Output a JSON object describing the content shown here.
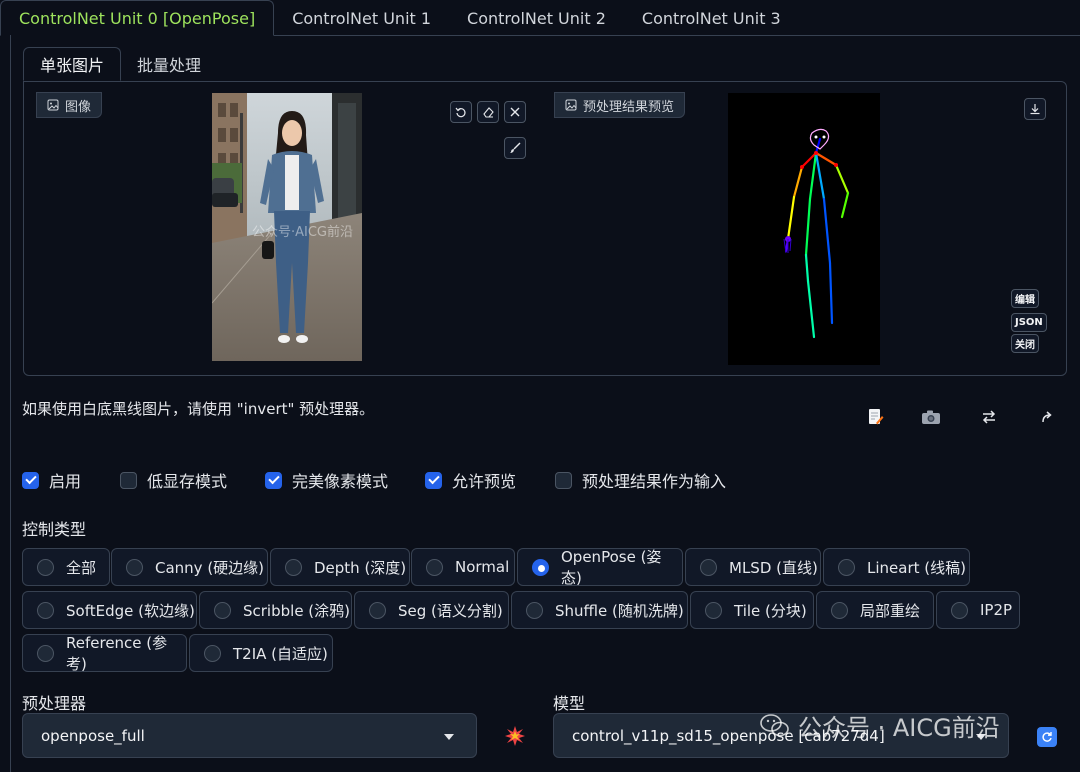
{
  "unit_tabs": [
    "ControlNet Unit 0 [OpenPose]",
    "ControlNet Unit 1",
    "ControlNet Unit 2",
    "ControlNet Unit 3"
  ],
  "sub_tabs": [
    "单张图片",
    "批量处理"
  ],
  "image_label": "图像",
  "preview_label": "预处理结果预览",
  "pose_buttons": {
    "edit": "编辑",
    "json": "JSON",
    "close": "关闭"
  },
  "photo_watermark": "公众号·AICG前沿",
  "hint": "如果使用白底黑线图片，请使用 \"invert\" 预处理器。",
  "checkboxes": [
    {
      "label": "启用",
      "checked": true
    },
    {
      "label": "低显存模式",
      "checked": false
    },
    {
      "label": "完美像素模式",
      "checked": true
    },
    {
      "label": "允许预览",
      "checked": true
    },
    {
      "label": "预处理结果作为输入",
      "checked": false
    }
  ],
  "control_type_label": "控制类型",
  "control_types": [
    {
      "label": "全部",
      "selected": false
    },
    {
      "label": "Canny (硬边缘)",
      "selected": false
    },
    {
      "label": "Depth (深度)",
      "selected": false
    },
    {
      "label": "Normal",
      "selected": false
    },
    {
      "label": "OpenPose (姿态)",
      "selected": true
    },
    {
      "label": "MLSD (直线)",
      "selected": false
    },
    {
      "label": "Lineart (线稿)",
      "selected": false
    },
    {
      "label": "SoftEdge (软边缘)",
      "selected": false
    },
    {
      "label": "Scribble (涂鸦)",
      "selected": false
    },
    {
      "label": "Seg (语义分割)",
      "selected": false
    },
    {
      "label": "Shuffle (随机洗牌)",
      "selected": false
    },
    {
      "label": "Tile (分块)",
      "selected": false
    },
    {
      "label": "局部重绘",
      "selected": false
    },
    {
      "label": "IP2P",
      "selected": false
    },
    {
      "label": "Reference (参考)",
      "selected": false
    },
    {
      "label": "T2IA (自适应)",
      "selected": false
    }
  ],
  "preprocessor_label": "预处理器",
  "preprocessor_value": "openpose_full",
  "model_label": "模型",
  "model_value": "control_v11p_sd15_openpose [cab727d4]",
  "watermark": "公众号 · AICG前沿",
  "colors": {
    "accent_green": "#9ee35d",
    "check_blue": "#2563eb",
    "background": "#0b0f19"
  },
  "icons": [
    "image-icon",
    "undo-icon",
    "eraser-icon",
    "close-icon",
    "brush-icon",
    "download-icon",
    "edit-doc-icon",
    "camera-icon",
    "swap-icon",
    "send-icon",
    "explosion-icon"
  ]
}
